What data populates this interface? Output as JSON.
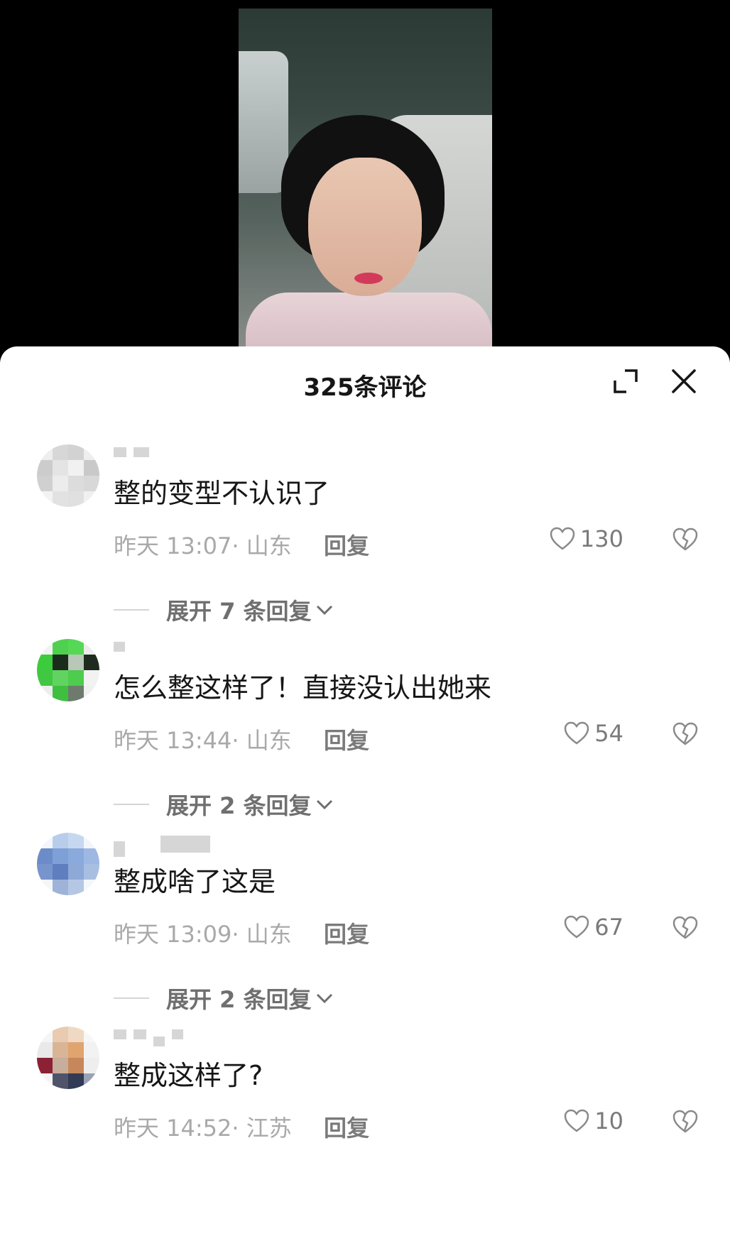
{
  "sheet": {
    "title": "325条评论"
  },
  "comments": [
    {
      "text": "整的变型不认识了",
      "meta": "昨天 13:07· 山东",
      "reply": "回复",
      "likes": "130",
      "expand": "展开 7 条回复",
      "avatar_colors": [
        "#eeeeee",
        "#d7d7d7",
        "#d2d2d2",
        "#eeeeee",
        "#cccccc",
        "#e4e4e4",
        "#f1f1f1",
        "#c9c9c9",
        "#d0d0d0",
        "#ececec",
        "#dcdcdc",
        "#d8d8d8",
        "#f3f3f3",
        "#e2e2e2",
        "#e0e0e0",
        "#f0f0f0"
      ]
    },
    {
      "text": "怎么整这样了！直接没认出她来",
      "meta": "昨天 13:44· 山东",
      "reply": "回复",
      "likes": "54",
      "expand": "展开 2 条回复",
      "avatar_colors": [
        "#f2f2f2",
        "#4fd04f",
        "#55d855",
        "#ececec",
        "#3ccb3c",
        "#1c2c1c",
        "#b9c7b9",
        "#1f2b1f",
        "#42c742",
        "#61d361",
        "#4dcc4d",
        "#f2f2f2",
        "#ededed",
        "#3fbf3f",
        "#6e7a6e",
        "#f0f0f0"
      ]
    },
    {
      "text": "整成啥了这是",
      "meta": "昨天 13:09· 山东",
      "reply": "回复",
      "likes": "67",
      "expand": "展开 2 条回复",
      "avatar_colors": [
        "#f3f6fb",
        "#b7cdea",
        "#c6d8ef",
        "#f2f5fa",
        "#6b8cc9",
        "#7ea0d7",
        "#8aa9dc",
        "#9db8e3",
        "#7894cc",
        "#5e7ebf",
        "#8ea9d8",
        "#a9bfe2",
        "#f3f6fb",
        "#9fb3d8",
        "#b5c7e5",
        "#f4f7fb"
      ]
    },
    {
      "text": "整成这样了?",
      "meta": "昨天 14:52· 江苏",
      "reply": "回复",
      "likes": "10",
      "expand": "",
      "avatar_colors": [
        "#f5f5f5",
        "#e8cbb0",
        "#f0d9c4",
        "#f7f7f7",
        "#e9e9e9",
        "#d9b596",
        "#e0a46f",
        "#f2f2f2",
        "#8c2136",
        "#c7ad9b",
        "#c8875a",
        "#eeeeee",
        "#f4f4f4",
        "#50546a",
        "#333a55",
        "#9aa2b4"
      ]
    }
  ]
}
